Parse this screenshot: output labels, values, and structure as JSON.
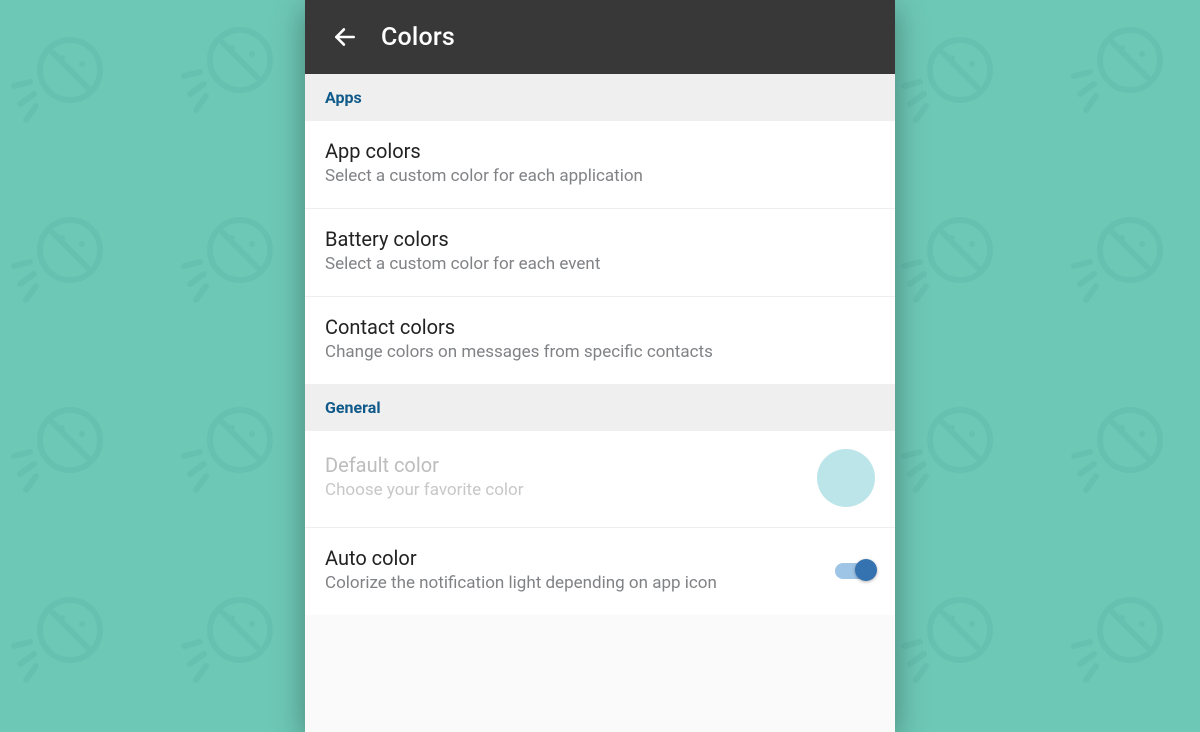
{
  "appbar": {
    "title": "Colors"
  },
  "sections": {
    "apps": {
      "header": "Apps",
      "items": [
        {
          "title": "App colors",
          "subtitle": "Select a custom color for each application"
        },
        {
          "title": "Battery colors",
          "subtitle": "Select a custom color for each event"
        },
        {
          "title": "Contact colors",
          "subtitle": "Change colors on messages from specific contacts"
        }
      ]
    },
    "general": {
      "header": "General",
      "default_color": {
        "title": "Default color",
        "subtitle": "Choose your favorite color",
        "swatch": "#bce5ea"
      },
      "auto_color": {
        "title": "Auto color",
        "subtitle": "Colorize the notification light depending on app icon",
        "enabled": true
      }
    }
  },
  "colors": {
    "appbar_bg": "#383838",
    "section_header_text": "#0f5a8a",
    "switch_thumb": "#3572b0",
    "switch_track": "#9fc5e6"
  }
}
